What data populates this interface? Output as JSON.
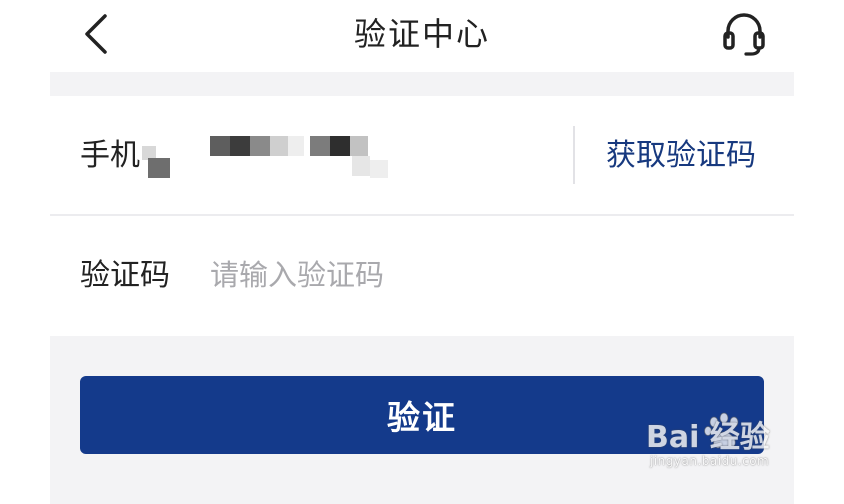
{
  "header": {
    "title": "验证中心",
    "back_icon": "chevron-left-icon",
    "support_icon": "headset-icon"
  },
  "form": {
    "phone_label": "手机",
    "phone_value_masked": "",
    "get_code_label": "获取验证码",
    "code_label": "验证码",
    "code_placeholder": "请输入验证码",
    "code_value": ""
  },
  "verify_button": {
    "label": "验证"
  },
  "watermark": {
    "logo_text": "Bai 经验",
    "url": "jingyan.baidu.com"
  },
  "colors": {
    "primary": "#143a8b",
    "link": "#17397f",
    "panel_background": "#f3f3f5",
    "text": "#222222",
    "placeholder": "#a9a9ad"
  }
}
